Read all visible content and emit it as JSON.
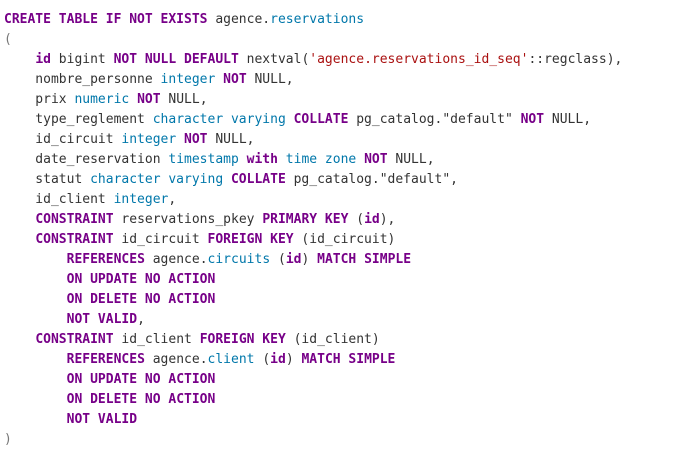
{
  "colors": {
    "keyword": "#770088",
    "type": "#0077aa",
    "string": "#aa1111",
    "plain": "#333333",
    "punct": "#777777",
    "background": "#ffffff"
  },
  "code_lines": [
    [
      {
        "t": "CREATE TABLE IF NOT EXISTS",
        "c": "kw"
      },
      {
        "t": " agence.",
        "c": "pl"
      },
      {
        "t": "reservations",
        "c": "ty"
      }
    ],
    [
      {
        "t": "(",
        "c": "pu"
      }
    ],
    [
      {
        "t": "    ",
        "c": "pl"
      },
      {
        "t": "id",
        "c": "kw"
      },
      {
        "t": " bigint ",
        "c": "pl"
      },
      {
        "t": "NOT NULL DEFAULT",
        "c": "kw"
      },
      {
        "t": " nextval(",
        "c": "pl"
      },
      {
        "t": "'agence.reservations_id_seq'",
        "c": "str"
      },
      {
        "t": "::regclass),",
        "c": "pl"
      }
    ],
    [
      {
        "t": "    nombre_personne ",
        "c": "pl"
      },
      {
        "t": "integer",
        "c": "ty"
      },
      {
        "t": " ",
        "c": "pl"
      },
      {
        "t": "NOT",
        "c": "kw"
      },
      {
        "t": " NULL,",
        "c": "pl"
      }
    ],
    [
      {
        "t": "    prix ",
        "c": "pl"
      },
      {
        "t": "numeric",
        "c": "ty"
      },
      {
        "t": " ",
        "c": "pl"
      },
      {
        "t": "NOT",
        "c": "kw"
      },
      {
        "t": " NULL,",
        "c": "pl"
      }
    ],
    [
      {
        "t": "    type_reglement ",
        "c": "pl"
      },
      {
        "t": "character varying",
        "c": "ty"
      },
      {
        "t": " ",
        "c": "pl"
      },
      {
        "t": "COLLATE",
        "c": "kw"
      },
      {
        "t": " pg_catalog.\"default\" ",
        "c": "pl"
      },
      {
        "t": "NOT",
        "c": "kw"
      },
      {
        "t": " NULL,",
        "c": "pl"
      }
    ],
    [
      {
        "t": "    id_circuit ",
        "c": "pl"
      },
      {
        "t": "integer",
        "c": "ty"
      },
      {
        "t": " ",
        "c": "pl"
      },
      {
        "t": "NOT",
        "c": "kw"
      },
      {
        "t": " NULL,",
        "c": "pl"
      }
    ],
    [
      {
        "t": "    date_reservation ",
        "c": "pl"
      },
      {
        "t": "timestamp",
        "c": "ty"
      },
      {
        "t": " ",
        "c": "pl"
      },
      {
        "t": "with",
        "c": "kw"
      },
      {
        "t": " ",
        "c": "pl"
      },
      {
        "t": "time zone",
        "c": "ty"
      },
      {
        "t": " ",
        "c": "pl"
      },
      {
        "t": "NOT",
        "c": "kw"
      },
      {
        "t": " NULL,",
        "c": "pl"
      }
    ],
    [
      {
        "t": "    statut ",
        "c": "pl"
      },
      {
        "t": "character varying",
        "c": "ty"
      },
      {
        "t": " ",
        "c": "pl"
      },
      {
        "t": "COLLATE",
        "c": "kw"
      },
      {
        "t": " pg_catalog.\"default\",",
        "c": "pl"
      }
    ],
    [
      {
        "t": "    id_client ",
        "c": "pl"
      },
      {
        "t": "integer",
        "c": "ty"
      },
      {
        "t": ",",
        "c": "pl"
      }
    ],
    [
      {
        "t": "    ",
        "c": "pl"
      },
      {
        "t": "CONSTRAINT",
        "c": "kw"
      },
      {
        "t": " reservations_pkey ",
        "c": "pl"
      },
      {
        "t": "PRIMARY KEY",
        "c": "kw"
      },
      {
        "t": " (",
        "c": "pl"
      },
      {
        "t": "id",
        "c": "kw"
      },
      {
        "t": "),",
        "c": "pl"
      }
    ],
    [
      {
        "t": "    ",
        "c": "pl"
      },
      {
        "t": "CONSTRAINT",
        "c": "kw"
      },
      {
        "t": " id_circuit ",
        "c": "pl"
      },
      {
        "t": "FOREIGN KEY",
        "c": "kw"
      },
      {
        "t": " (id_circuit)",
        "c": "pl"
      }
    ],
    [
      {
        "t": "        ",
        "c": "pl"
      },
      {
        "t": "REFERENCES",
        "c": "kw"
      },
      {
        "t": " agence.",
        "c": "pl"
      },
      {
        "t": "circuits",
        "c": "ty"
      },
      {
        "t": " (",
        "c": "pl"
      },
      {
        "t": "id",
        "c": "kw"
      },
      {
        "t": ") ",
        "c": "pl"
      },
      {
        "t": "MATCH SIMPLE",
        "c": "kw"
      }
    ],
    [
      {
        "t": "        ",
        "c": "pl"
      },
      {
        "t": "ON UPDATE NO ACTION",
        "c": "kw"
      }
    ],
    [
      {
        "t": "        ",
        "c": "pl"
      },
      {
        "t": "ON DELETE NO ACTION",
        "c": "kw"
      }
    ],
    [
      {
        "t": "        ",
        "c": "pl"
      },
      {
        "t": "NOT VALID",
        "c": "kw"
      },
      {
        "t": ",",
        "c": "pl"
      }
    ],
    [
      {
        "t": "    ",
        "c": "pl"
      },
      {
        "t": "CONSTRAINT",
        "c": "kw"
      },
      {
        "t": " id_client ",
        "c": "pl"
      },
      {
        "t": "FOREIGN KEY",
        "c": "kw"
      },
      {
        "t": " (id_client)",
        "c": "pl"
      }
    ],
    [
      {
        "t": "        ",
        "c": "pl"
      },
      {
        "t": "REFERENCES",
        "c": "kw"
      },
      {
        "t": " agence.",
        "c": "pl"
      },
      {
        "t": "client",
        "c": "ty"
      },
      {
        "t": " (",
        "c": "pl"
      },
      {
        "t": "id",
        "c": "kw"
      },
      {
        "t": ") ",
        "c": "pl"
      },
      {
        "t": "MATCH SIMPLE",
        "c": "kw"
      }
    ],
    [
      {
        "t": "        ",
        "c": "pl"
      },
      {
        "t": "ON UPDATE NO ACTION",
        "c": "kw"
      }
    ],
    [
      {
        "t": "        ",
        "c": "pl"
      },
      {
        "t": "ON DELETE NO ACTION",
        "c": "kw"
      }
    ],
    [
      {
        "t": "        ",
        "c": "pl"
      },
      {
        "t": "NOT VALID",
        "c": "kw"
      }
    ],
    [
      {
        "t": ")",
        "c": "pu"
      }
    ]
  ]
}
